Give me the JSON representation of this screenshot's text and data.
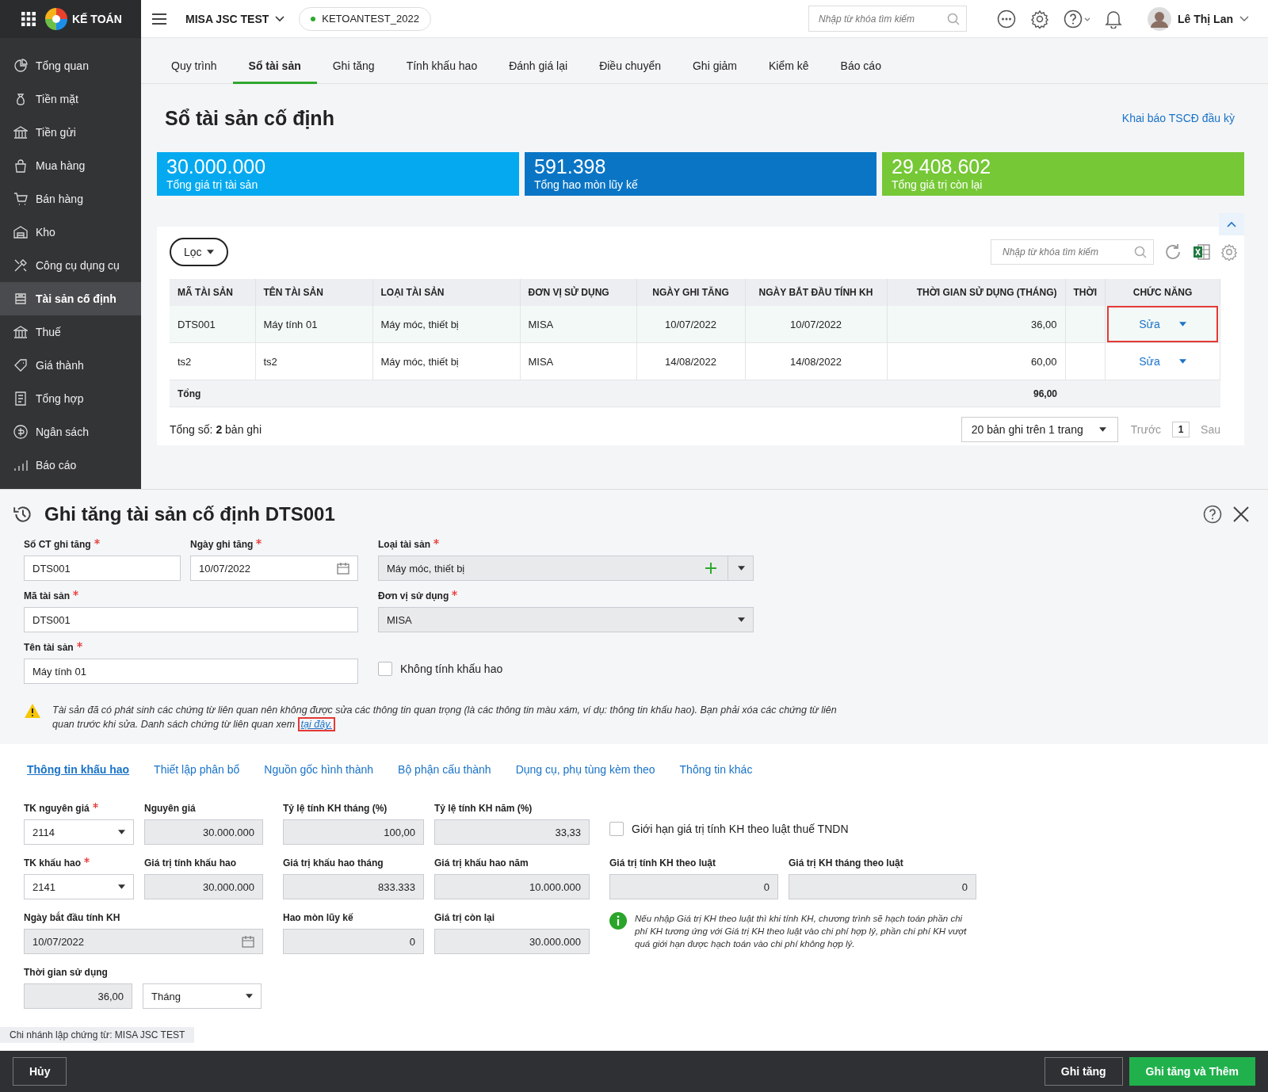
{
  "app": {
    "brand": "KẾ TOÁN",
    "company": "MISA JSC TEST",
    "database": "KETOANTEST_2022",
    "search_placeholder": "Nhập từ khóa tìm kiếm",
    "user": "Lê Thị Lan"
  },
  "sidebar": {
    "items": [
      {
        "label": "Tổng quan",
        "selected": false
      },
      {
        "label": "Tiền mặt",
        "selected": false
      },
      {
        "label": "Tiền gửi",
        "selected": false
      },
      {
        "label": "Mua hàng",
        "selected": false
      },
      {
        "label": "Bán hàng",
        "selected": false
      },
      {
        "label": "Kho",
        "selected": false
      },
      {
        "label": "Công cụ dụng cụ",
        "selected": false
      },
      {
        "label": "Tài sản cố định",
        "selected": true
      },
      {
        "label": "Thuế",
        "selected": false
      },
      {
        "label": "Giá thành",
        "selected": false
      },
      {
        "label": "Tổng hợp",
        "selected": false
      },
      {
        "label": "Ngân sách",
        "selected": false
      },
      {
        "label": "Báo cáo",
        "selected": false
      }
    ]
  },
  "tabs": [
    {
      "label": "Quy trình",
      "selected": false
    },
    {
      "label": "Sổ tài sản",
      "selected": true
    },
    {
      "label": "Ghi tăng",
      "selected": false
    },
    {
      "label": "Tính khấu hao",
      "selected": false
    },
    {
      "label": "Đánh giá lại",
      "selected": false
    },
    {
      "label": "Điều chuyển",
      "selected": false
    },
    {
      "label": "Ghi giảm",
      "selected": false
    },
    {
      "label": "Kiểm kê",
      "selected": false
    },
    {
      "label": "Báo cáo",
      "selected": false
    }
  ],
  "page": {
    "title": "Sổ tài sản cố định",
    "link": "Khai báo TSCĐ đầu kỳ"
  },
  "summary_cards": [
    {
      "value": "30.000.000",
      "label": "Tổng giá trị tài sản",
      "color": "#04a9f0"
    },
    {
      "value": "591.398",
      "label": "Tổng hao mòn lũy kế",
      "color": "#0a75c5"
    },
    {
      "value": "29.408.602",
      "label": "Tổng giá trị còn lại",
      "color": "#76c836"
    }
  ],
  "table": {
    "filter_label": "Lọc",
    "search_placeholder": "Nhập từ khóa tìm kiếm",
    "columns": [
      "MÃ TÀI SẢN",
      "TÊN TÀI SẢN",
      "LOẠI TÀI SẢN",
      "ĐƠN VỊ SỬ DỤNG",
      "NGÀY GHI TĂNG",
      "NGÀY BẮT ĐẦU TÍNH KH",
      "THỜI GIAN SỬ DỤNG (THÁNG)",
      "THỜI",
      "CHỨC NĂNG"
    ],
    "rows": [
      {
        "cells": [
          "DTS001",
          "Máy tính 01",
          "Máy móc, thiết bị",
          "MISA",
          "10/07/2022",
          "10/07/2022",
          "36,00"
        ],
        "action": "Sửa",
        "highlighted": true
      },
      {
        "cells": [
          "ts2",
          "ts2",
          "Máy móc, thiết bị",
          "MISA",
          "14/08/2022",
          "14/08/2022",
          "60,00"
        ],
        "action": "Sửa",
        "highlighted": false
      }
    ],
    "total": {
      "label": "Tổng",
      "value": "96,00"
    },
    "record_count": "Tổng số: **2** bản ghi",
    "page_size": "20 bản ghi trên 1 trang",
    "prev": "Trước",
    "page": "1",
    "next": "Sau"
  },
  "form": {
    "title": "Ghi tăng tài sản cố định DTS001",
    "fields": [
      {
        "kind": "text",
        "label": "Số CT ghi tăng",
        "required": true,
        "value": "DTS001",
        "disabled": false
      },
      {
        "kind": "date",
        "label": "Ngày ghi tăng",
        "required": true,
        "value": "10/07/2022",
        "disabled": false
      },
      {
        "kind": "combo",
        "label": "Loại tài sản",
        "required": true,
        "value": "Máy móc, thiết bị",
        "disabled": true
      },
      {
        "kind": "text",
        "label": "Mã tài sản",
        "required": true,
        "value": "DTS001",
        "disabled": false
      },
      {
        "kind": "select",
        "label": "Đơn vị sử dụng",
        "required": true,
        "value": "MISA",
        "disabled": true
      },
      {
        "kind": "text",
        "label": "Tên tài sản",
        "required": true,
        "value": "Máy tính 01",
        "disabled": false
      },
      {
        "kind": "checkbox",
        "label": "Không tính khấu hao",
        "checked": false
      }
    ],
    "warning": {
      "text": "Tài sản đã có phát sinh các chứng từ liên quan nên không được sửa các thông tin quan trọng (là các thông tin màu xám, ví dụ: thông tin khấu hao). Bạn phải xóa các chứng từ liên quan trước khi sửa. Danh sách chứng từ liên quan xem",
      "link": "tại đây.",
      "highlighted": true
    },
    "detail_tabs": [
      {
        "label": "Thông tin khấu hao",
        "selected": true
      },
      {
        "label": "Thiết lập phân bổ",
        "selected": false
      },
      {
        "label": "Nguồn gốc hình thành",
        "selected": false
      },
      {
        "label": "Bộ phận cấu thành",
        "selected": false
      },
      {
        "label": "Dụng cụ, phụ tùng kèm theo",
        "selected": false
      },
      {
        "label": "Thông tin khác",
        "selected": false
      }
    ],
    "detail_fields": [
      {
        "kind": "select",
        "label": "TK nguyên giá",
        "required": true,
        "value": "2114",
        "disabled": false
      },
      {
        "kind": "number",
        "label": "Nguyên giá",
        "required": false,
        "value": "30.000.000",
        "disabled": true
      },
      {
        "kind": "number",
        "label": "Tỷ lệ tính KH tháng (%)",
        "required": false,
        "value": "100,00",
        "disabled": true
      },
      {
        "kind": "number",
        "label": "Tỷ lệ tính KH năm (%)",
        "required": false,
        "value": "33,33",
        "disabled": true
      },
      {
        "kind": "checkbox",
        "label": "Giới hạn giá trị tính KH theo luật thuế TNDN",
        "checked": false
      },
      {
        "kind": "select",
        "label": "TK khấu hao",
        "required": true,
        "value": "2141",
        "disabled": false
      },
      {
        "kind": "number",
        "label": "Giá trị tính khấu hao",
        "required": false,
        "value": "30.000.000",
        "disabled": true
      },
      {
        "kind": "number",
        "label": "Giá trị khấu hao tháng",
        "required": false,
        "value": "833.333",
        "disabled": true
      },
      {
        "kind": "number",
        "label": "Giá trị khấu hao năm",
        "required": false,
        "value": "10.000.000",
        "disabled": true
      },
      {
        "kind": "number",
        "label": "Giá trị tính KH theo luật",
        "required": false,
        "value": "0",
        "disabled": true
      },
      {
        "kind": "number",
        "label": "Giá trị KH tháng theo luật",
        "required": false,
        "value": "0",
        "disabled": true
      },
      {
        "kind": "date",
        "label": "Ngày bắt đầu tính KH",
        "required": false,
        "value": "10/07/2022",
        "disabled": true
      },
      {
        "kind": "number",
        "label": "Hao mòn lũy kế",
        "required": false,
        "value": "0",
        "disabled": true
      },
      {
        "kind": "number",
        "label": "Giá trị còn lại",
        "required": false,
        "value": "30.000.000",
        "disabled": true
      },
      {
        "kind": "note",
        "text": "Nếu nhập Giá trị KH theo luật thì khi tính KH, chương trình sẽ hạch toán phần chi phí KH tương ứng với Giá trị KH theo luật vào chi phí hợp lý, phần chi phí KH vượt quá giới hạn được hạch toán vào chi phí không hợp lý."
      },
      {
        "kind": "duration",
        "label": "Thời gian sử dụng",
        "required": false,
        "value": "36,00",
        "unit": "Tháng",
        "disabled": true
      }
    ],
    "branch": "Chi nhánh lập chứng từ: MISA JSC TEST",
    "buttons": [
      {
        "label": "Hủy",
        "kind": "secondary"
      },
      {
        "label": "Ghi tăng",
        "kind": "secondary"
      },
      {
        "label": "Ghi tăng và Thêm",
        "kind": "primary"
      }
    ]
  }
}
